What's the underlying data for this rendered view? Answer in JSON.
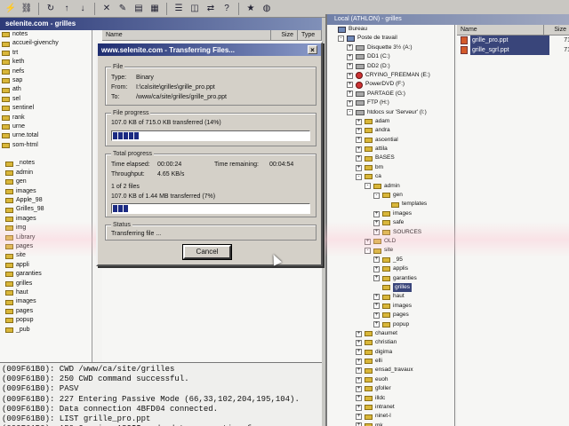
{
  "left_panel": {
    "title": "selenite.com - grilles",
    "tree_items": [
      "notes",
      "accueil-givenchy",
      "trt",
      "keth",
      "nefs",
      "sap",
      "ath",
      "sel",
      "sentinel",
      "rank",
      "urne",
      "urne.total",
      "som-html",
      "",
      "_notes",
      "admin",
      "gen",
      "images",
      "Apple_98",
      "Grilles_98",
      "images",
      "img",
      "Library",
      "pages",
      "site",
      "appli",
      "garanties",
      "grilles",
      "haut",
      "images",
      "pages",
      "popup",
      "_pub"
    ],
    "columns": {
      "name": "Name",
      "size": "Size",
      "type": "Type"
    }
  },
  "log": {
    "lines": [
      "(009F61B0): CWD /www/ca/site/grilles",
      "(009F61B0): 250 CWD command successful.",
      "(009F61B0): PASV",
      "(009F61B0): 227 Entering Passive Mode (66,33,102,204,195,104).",
      "(009F61B0): Data connection 4BFD04 connected.",
      "(009F61B0): LIST grille_pro.ppt",
      "(009F61B0): 150 Opening ASCII mode data connection for"
    ]
  },
  "right_panel": {
    "title": "Local (ATHLON) - grilles",
    "columns": {
      "name": "Name",
      "size": "Size"
    },
    "tree": [
      {
        "label": "Bureau",
        "icon": "pc",
        "indent": 0,
        "exp": ""
      },
      {
        "label": "Poste de travail",
        "icon": "pc",
        "indent": 1,
        "exp": "-"
      },
      {
        "label": "Disquette 3½ (A:)",
        "icon": "drive",
        "indent": 2,
        "exp": "+"
      },
      {
        "label": "DD1 (C:)",
        "icon": "drive",
        "indent": 2,
        "exp": "+"
      },
      {
        "label": "DD2 (D:)",
        "icon": "drive",
        "indent": 2,
        "exp": "+"
      },
      {
        "label": "CRYING_FREEMAN (E:)",
        "icon": "cd",
        "indent": 2,
        "exp": "+"
      },
      {
        "label": "PowerDVD (F:)",
        "icon": "cd",
        "indent": 2,
        "exp": "+"
      },
      {
        "label": "PARTAGE (G:)",
        "icon": "drive",
        "indent": 2,
        "exp": "+"
      },
      {
        "label": "FTP (H:)",
        "icon": "drive",
        "indent": 2,
        "exp": "+"
      },
      {
        "label": "htdocs sur 'Serveur' (I:)",
        "icon": "drive",
        "indent": 2,
        "exp": "-"
      },
      {
        "label": "adam",
        "icon": "folder",
        "indent": 3,
        "exp": "+"
      },
      {
        "label": "andra",
        "icon": "folder",
        "indent": 3,
        "exp": "+"
      },
      {
        "label": "ascential",
        "icon": "folder",
        "indent": 3,
        "exp": "+"
      },
      {
        "label": "attila",
        "icon": "folder",
        "indent": 3,
        "exp": "+"
      },
      {
        "label": "BASES",
        "icon": "folder",
        "indent": 3,
        "exp": "+"
      },
      {
        "label": "bm",
        "icon": "folder",
        "indent": 3,
        "exp": "+"
      },
      {
        "label": "ca",
        "icon": "folder",
        "indent": 3,
        "exp": "-"
      },
      {
        "label": "admin",
        "icon": "folder",
        "indent": 4,
        "exp": "-"
      },
      {
        "label": "gen",
        "icon": "folder",
        "indent": 5,
        "exp": "-"
      },
      {
        "label": "templates",
        "icon": "folder",
        "indent": 6,
        "exp": ""
      },
      {
        "label": "images",
        "icon": "folder",
        "indent": 5,
        "exp": "+"
      },
      {
        "label": "safe",
        "icon": "folder",
        "indent": 5,
        "exp": "+"
      },
      {
        "label": "SOURCES",
        "icon": "folder",
        "indent": 5,
        "exp": "+"
      },
      {
        "label": "OLD",
        "icon": "folder",
        "indent": 4,
        "exp": "+"
      },
      {
        "label": "site",
        "icon": "folder",
        "indent": 4,
        "exp": "-"
      },
      {
        "label": "_95",
        "icon": "folder",
        "indent": 5,
        "exp": "+"
      },
      {
        "label": "applis",
        "icon": "folder",
        "indent": 5,
        "exp": "+"
      },
      {
        "label": "garanties",
        "icon": "folder",
        "indent": 5,
        "exp": "+"
      },
      {
        "label": "grilles",
        "icon": "folder",
        "indent": 5,
        "exp": ""
      },
      {
        "label": "haut",
        "icon": "folder",
        "indent": 5,
        "exp": "+"
      },
      {
        "label": "images",
        "icon": "folder",
        "indent": 5,
        "exp": "+"
      },
      {
        "label": "pages",
        "icon": "folder",
        "indent": 5,
        "exp": "+"
      },
      {
        "label": "popup",
        "icon": "folder",
        "indent": 5,
        "exp": "+"
      },
      {
        "label": "chaumet",
        "icon": "folder",
        "indent": 3,
        "exp": "+"
      },
      {
        "label": "christian",
        "icon": "folder",
        "indent": 3,
        "exp": "+"
      },
      {
        "label": "digima",
        "icon": "folder",
        "indent": 3,
        "exp": "+"
      },
      {
        "label": "elli",
        "icon": "folder",
        "indent": 3,
        "exp": "+"
      },
      {
        "label": "ensad_travaux",
        "icon": "folder",
        "indent": 3,
        "exp": "+"
      },
      {
        "label": "euoh",
        "icon": "folder",
        "indent": 3,
        "exp": "+"
      },
      {
        "label": "gfoller",
        "icon": "folder",
        "indent": 3,
        "exp": "+"
      },
      {
        "label": "illdc",
        "icon": "folder",
        "indent": 3,
        "exp": "+"
      },
      {
        "label": "intranet",
        "icon": "folder",
        "indent": 3,
        "exp": "+"
      },
      {
        "label": "ninet-l",
        "icon": "folder",
        "indent": 3,
        "exp": "+"
      },
      {
        "label": "mk",
        "icon": "folder",
        "indent": 3,
        "exp": "+"
      }
    ],
    "files": [
      {
        "name": "grille_pro.ppt",
        "size": "71"
      },
      {
        "name": "grille_sgrl.ppt",
        "size": "71"
      }
    ]
  },
  "dialog": {
    "title": "www.selenite.com - Transferring Files...",
    "close": "×",
    "file_group": "File",
    "type_label": "Type:",
    "type_value": "Binary",
    "from_label": "From:",
    "from_value": "I:\\ca\\site\\grilles\\grille_pro.ppt",
    "to_label": "To:",
    "to_value": "/www/ca/site/grilles/grille_pro.ppt",
    "file_progress_group": "File progress",
    "file_progress_text": "107.0 KB of 715.0 KB transferred (14%)",
    "file_progress_pct": 14,
    "total_group": "Total progress",
    "elapsed_label": "Time elapsed:",
    "elapsed_value": "00:00:24",
    "remaining_label": "Time remaining:",
    "remaining_value": "00:04:54",
    "throughput_label": "Throughput:",
    "throughput_value": "4.65 KB/s",
    "files_count": "1 of 2 files",
    "total_progress_text": "107.0 KB of 1.44 MB transferred (7%)",
    "total_progress_pct": 7,
    "status_group": "Status",
    "status_text": "Transferring file ...",
    "cancel": "Cancel"
  }
}
